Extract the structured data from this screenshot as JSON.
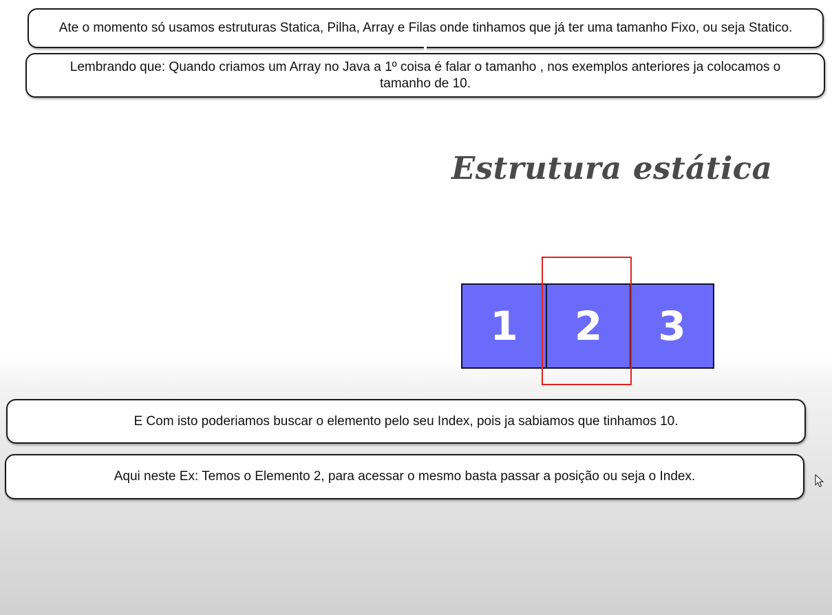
{
  "notes": {
    "note1": "Ate o momento só usamos estruturas Statica, Pilha, Array e Filas onde tinhamos que já ter uma tamanho Fixo, ou seja Statico.",
    "note2": "Lembrando que: Quando criamos um Array no Java a 1º coisa é falar o tamanho , nos exemplos anteriores ja colocamos o tamanho de 10.",
    "note3": "E Com isto poderiamos buscar o elemento pelo seu Index, pois ja sabiamos que tinhamos 10.",
    "note4": "Aqui neste Ex: Temos o Elemento 2, para acessar o mesmo basta passar a posição ou seja o Index."
  },
  "slide": {
    "title": "Estrutura estática",
    "cells": [
      "1",
      "2",
      "3"
    ],
    "highlighted_cell": "2"
  },
  "colors": {
    "cell_fill": "#6b6bfb",
    "cell_border": "#121230",
    "highlight": "#e02020",
    "title_text": "#4a4a4a"
  },
  "icons": {
    "cursor": "mouse-pointer-icon"
  }
}
